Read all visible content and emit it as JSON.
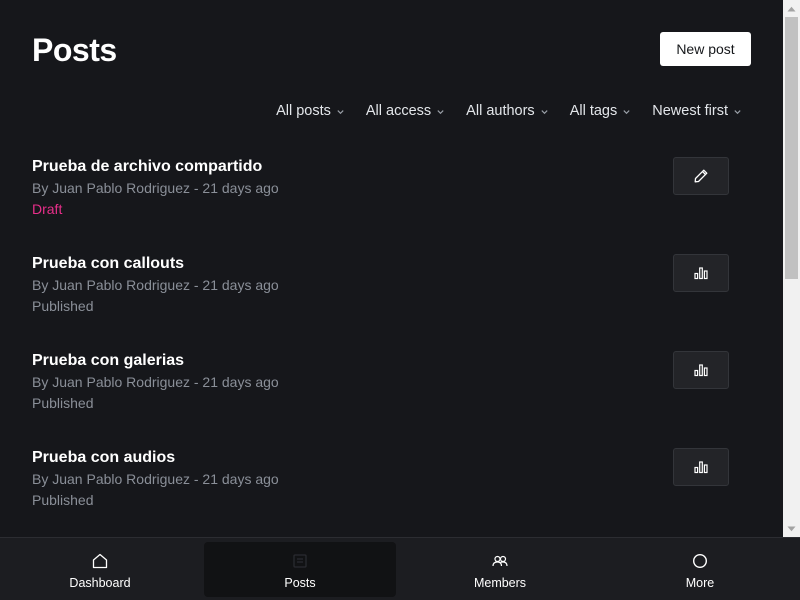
{
  "header": {
    "title": "Posts",
    "new_post_label": "New post"
  },
  "filters": [
    {
      "label": "All posts"
    },
    {
      "label": "All access"
    },
    {
      "label": "All authors"
    },
    {
      "label": "All tags"
    },
    {
      "label": "Newest first"
    }
  ],
  "posts": [
    {
      "title": "Prueba de archivo compartido",
      "meta": "By Juan Pablo Rodriguez - 21 days ago",
      "status": "Draft",
      "action_icon": "pencil-icon"
    },
    {
      "title": "Prueba con callouts",
      "meta": "By Juan Pablo Rodriguez - 21 days ago",
      "status": "Published",
      "action_icon": "analytics-icon"
    },
    {
      "title": "Prueba con galerias",
      "meta": "By Juan Pablo Rodriguez - 21 days ago",
      "status": "Published",
      "action_icon": "analytics-icon"
    },
    {
      "title": "Prueba con audios",
      "meta": "By Juan Pablo Rodriguez - 21 days ago",
      "status": "Published",
      "action_icon": "analytics-icon"
    }
  ],
  "nav": {
    "items": [
      {
        "label": "Dashboard",
        "icon": "home-icon"
      },
      {
        "label": "Posts",
        "icon": "posts-icon",
        "active": true
      },
      {
        "label": "Members",
        "icon": "members-icon"
      },
      {
        "label": "More",
        "icon": "more-icon"
      }
    ]
  },
  "colors": {
    "background": "#16171b",
    "draft": "#e82e8a",
    "muted": "#8a8f98",
    "button_bg": "#ffffff"
  }
}
